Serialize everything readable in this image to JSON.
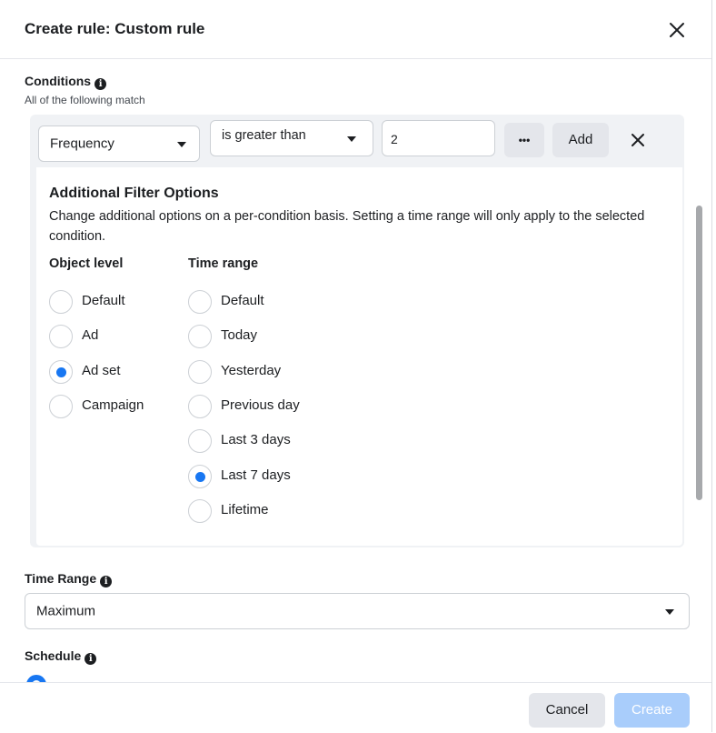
{
  "dialog": {
    "title": "Create rule: Custom rule"
  },
  "conditions": {
    "title": "Conditions",
    "subtitle": "All of the following match",
    "metric": "Frequency",
    "operator": "is greater than",
    "value": "2",
    "more_label": "•••",
    "add_label": "Add"
  },
  "filter": {
    "title": "Additional Filter Options",
    "description": "Change additional options on a per-condition basis. Setting a time range will only apply to the selected condition.",
    "object_level": {
      "heading": "Object level",
      "options": [
        {
          "label": "Default",
          "checked": false
        },
        {
          "label": "Ad",
          "checked": false
        },
        {
          "label": "Ad set",
          "checked": true
        },
        {
          "label": "Campaign",
          "checked": false
        }
      ]
    },
    "time_range": {
      "heading": "Time range",
      "options": [
        {
          "label": "Default",
          "checked": false
        },
        {
          "label": "Today",
          "checked": false
        },
        {
          "label": "Yesterday",
          "checked": false
        },
        {
          "label": "Previous day",
          "checked": false
        },
        {
          "label": "Last 3 days",
          "checked": false
        },
        {
          "label": "Last 7 days",
          "checked": true
        },
        {
          "label": "Lifetime",
          "checked": false
        }
      ]
    }
  },
  "time_range_section": {
    "title": "Time Range",
    "value": "Maximum"
  },
  "schedule": {
    "title": "Schedule"
  },
  "footer": {
    "cancel_label": "Cancel",
    "create_label": "Create"
  },
  "icons": {
    "info": "info-icon",
    "close": "close-icon",
    "caret": "caret-down-icon",
    "more": "more-icon"
  },
  "colors": {
    "accent": "#1877f2",
    "create_disabled": "#a9cdfb",
    "panel_bg": "#f0f2f5"
  }
}
